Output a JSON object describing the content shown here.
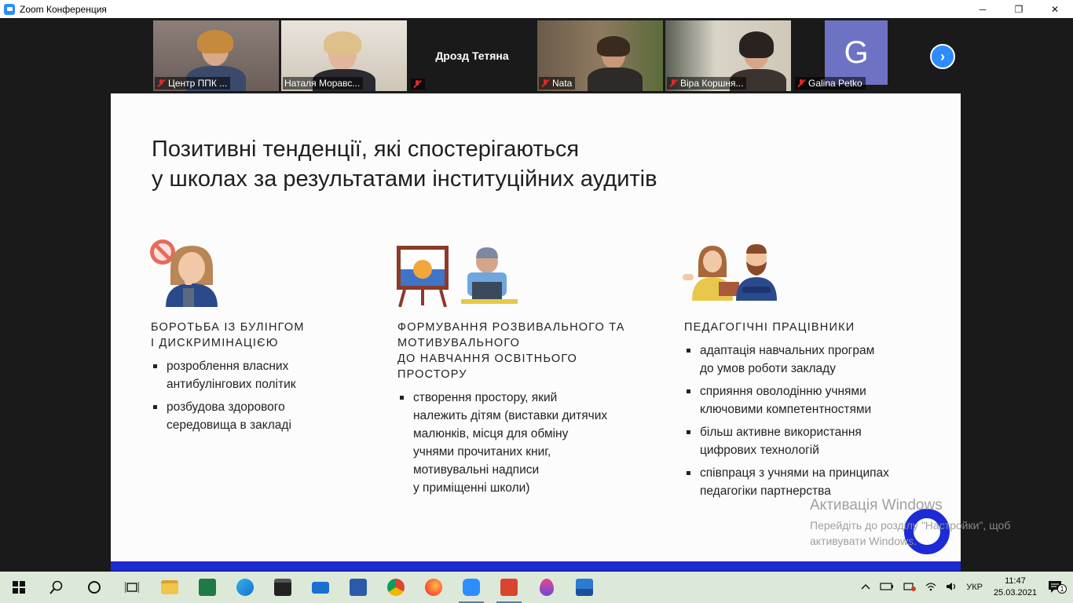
{
  "window": {
    "title": "Zoom Конференция",
    "minimize": "─",
    "restore": "❐",
    "close": "✕"
  },
  "participants": [
    {
      "name": "Центр ППК ...",
      "muted": true
    },
    {
      "name": "Наталя Моравс...",
      "muted": false,
      "speaking": true
    },
    {
      "name": "Дрозд Тетяна",
      "muted": true,
      "video": false
    },
    {
      "name": "Nata",
      "muted": true
    },
    {
      "name": "Віра Коршня...",
      "muted": true
    },
    {
      "name": "Galina Petko",
      "muted": true,
      "avatar_letter": "G"
    }
  ],
  "next_page_glyph": "›",
  "slide": {
    "title_line1": "Позитивні тенденції, які спостерігаються",
    "title_line2": "у школах за результатами інституційних аудитів",
    "columns": [
      {
        "heading_lines": [
          "БОРОТЬБА ІЗ БУЛІНГОМ",
          "І ДИСКРИМІНАЦІЄЮ"
        ],
        "bullets": [
          [
            "розроблення власних",
            "антибулінгових політик"
          ],
          [
            "розбудова здорового",
            "середовища в закладі"
          ]
        ]
      },
      {
        "heading_lines": [
          "ФОРМУВАННЯ РОЗВИВАЛЬНОГО ТА",
          "МОТИВУВАЛЬНОГО",
          "ДО НАВЧАННЯ ОСВІТНЬОГО",
          "ПРОСТОРУ"
        ],
        "bullets": [
          [
            "створення простору, який",
            "належить дітям (виставки дитячих",
            "малюнків, місця для обміну",
            "учнями прочитаних книг,",
            "мотивувальні надписи",
            "у приміщенні школи)"
          ]
        ]
      },
      {
        "heading_lines": [
          "ПЕДАГОГІЧНІ ПРАЦІВНИКИ"
        ],
        "bullets": [
          [
            "адаптація навчальних програм",
            "до умов роботи закладу"
          ],
          [
            "сприяння оволодінню учнями",
            "ключовими компетентностями"
          ],
          [
            "більш активне використання",
            "цифрових технологій"
          ],
          [
            "співпраця з учнями на принципах",
            "педагогіки партнерства"
          ]
        ]
      }
    ]
  },
  "watermark": {
    "line1": "Активація Windows",
    "line2": "Перейдіть до розділу \"Настройки\", щоб",
    "line3": "активувати Windows."
  },
  "taskbar": {
    "apps": [
      "start",
      "search",
      "cortana",
      "task-view",
      "file-explorer",
      "excel",
      "edge",
      "store",
      "mail",
      "word",
      "chrome",
      "firefox",
      "zoom",
      "presentation",
      "drop-app",
      "photos"
    ],
    "language": "УКР",
    "time": "11:47",
    "date": "25.03.2021",
    "notifications": "1"
  },
  "colors": {
    "slide_accent": "#1c2bd4",
    "zoom_blue": "#2d8cff",
    "muted_red": "#e02828",
    "speaker_border": "#a4d65e",
    "avatar_bg": "#6e72c5"
  }
}
